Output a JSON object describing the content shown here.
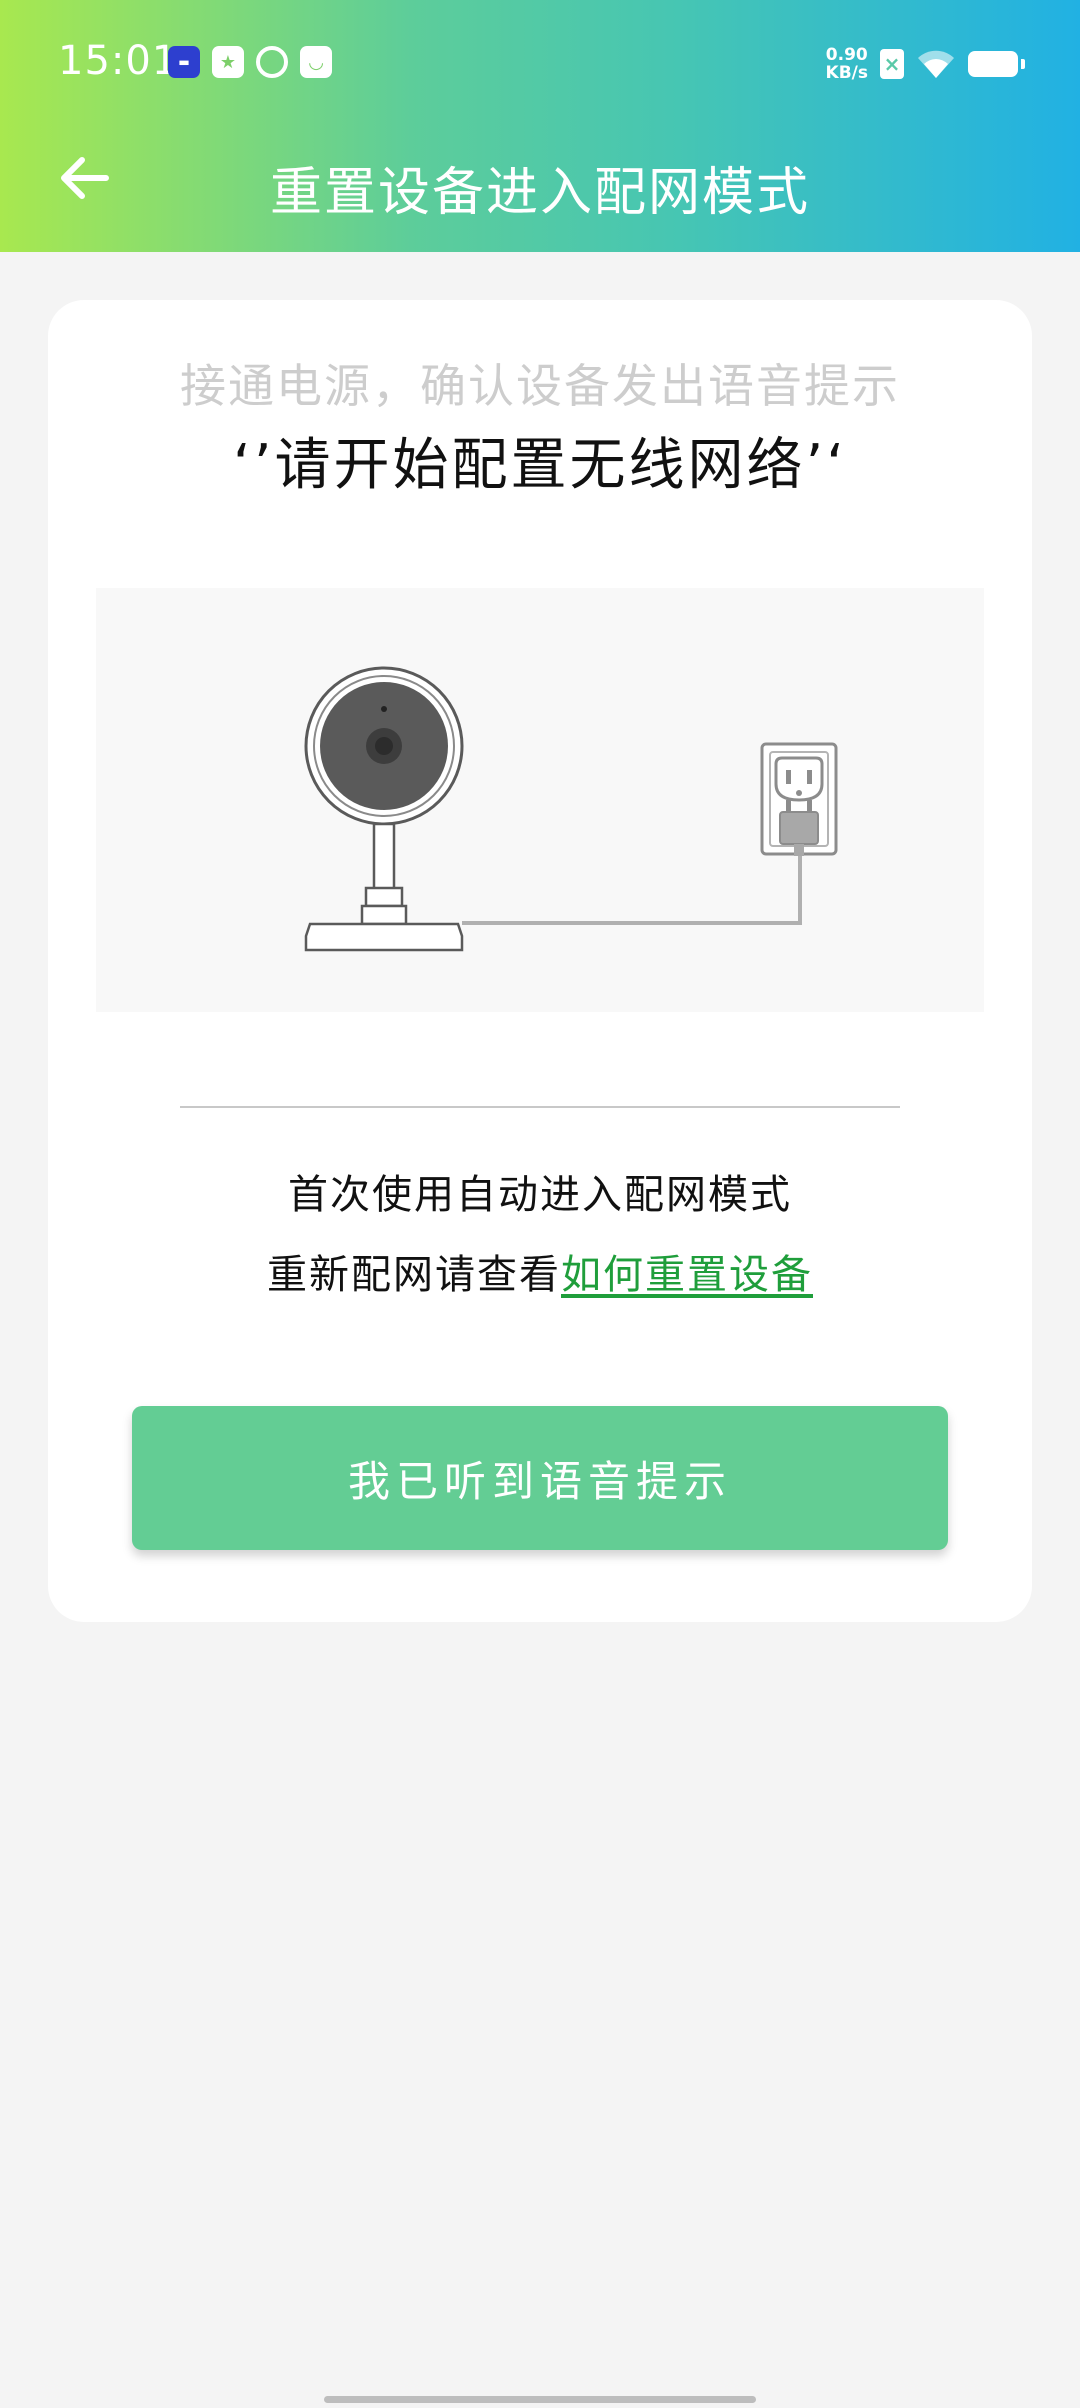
{
  "status_bar": {
    "time": "15:01",
    "net_speed_value": "0.90",
    "net_speed_unit": "KB/s",
    "notification_icons": [
      "news-app-icon",
      "star-message-icon",
      "leaf-app-icon",
      "mail-app-icon"
    ],
    "system_icons": [
      "sim-icon",
      "wifi-icon",
      "battery-icon"
    ]
  },
  "header": {
    "title": "重置设备进入配网模式",
    "back_icon": "arrow-left-icon",
    "gradient_colors": [
      "#a8e84f",
      "#5dcd9a",
      "#21b1e3"
    ]
  },
  "card": {
    "instruction_sub": "接通电源，确认设备发出语音提示",
    "instruction_main": "‘’请开始配置无线网络’‘",
    "illustration": "camera-plugged-into-outlet-illustration",
    "info_line_1": "首次使用自动进入配网模式",
    "info_line_2_prefix": "重新配网请查看",
    "reset_link": "如何重置设备",
    "confirm_button": "我已听到语音提示"
  },
  "colors": {
    "accent_green": "#63cd94",
    "link_green": "#1f9e3b",
    "background": "#f4f4f4",
    "subtle_text": "#cdcdcd"
  }
}
